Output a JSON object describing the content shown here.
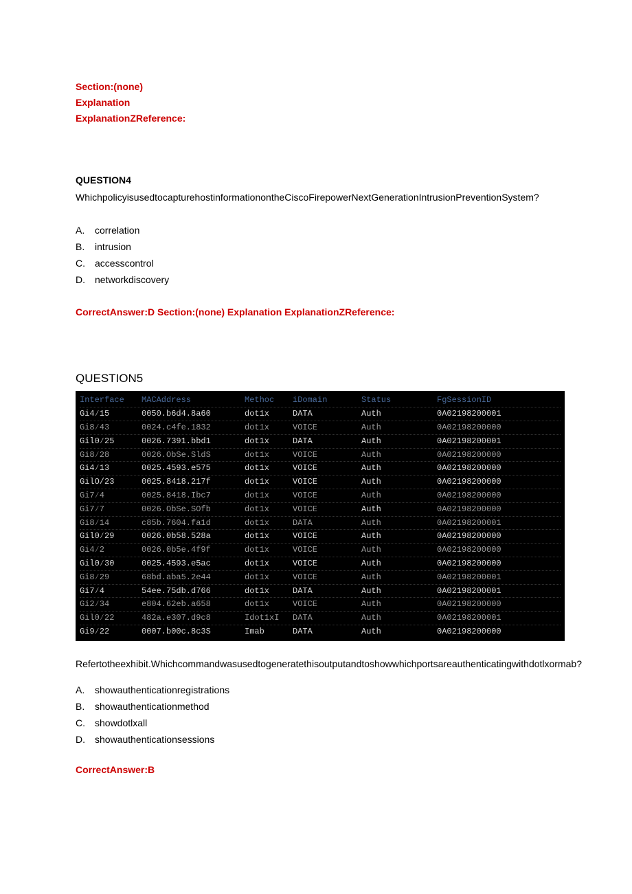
{
  "intro": {
    "section": "Section:(none)",
    "explanation": "Explanation",
    "expref": "ExplanationZReference:"
  },
  "q4": {
    "heading": "QUESTION4",
    "text": "WhichpolicyisusedtocapturehostinformationontheCiscoFirepowerNextGenerationIntrusionPreventionSystem?",
    "opts": [
      {
        "l": "A.",
        "t": "correlation"
      },
      {
        "l": "B.",
        "t": "intrusion"
      },
      {
        "l": "C.",
        "t": "accesscontrol"
      },
      {
        "l": "D.",
        "t": "networkdiscovery"
      }
    ],
    "correct": "CorrectAnswer:D",
    "section": "Section:(none)",
    "explanation": "Explanation",
    "expref": "ExplanationZReference:"
  },
  "q5": {
    "heading": "QUESTION5",
    "headers": {
      "c1": "Interface",
      "c2": "MACAddress",
      "c3": "Methoc",
      "c4": "iDomain",
      "c5": "Status",
      "c6": "FgSessionID"
    },
    "rows": [
      {
        "c1": "Gi4∕15",
        "c2": "0050.b6d4.8a60",
        "c3": "dot1x",
        "c4": "DATA",
        "c5": "Auth",
        "c6": "0A02198200001",
        "bright": true
      },
      {
        "c1": "Gi8∕43",
        "c2": "0024.c4fe.1832",
        "c3": "dot1x",
        "c4": "VOICE",
        "c5": "Auth",
        "c6": "0A02198200000"
      },
      {
        "c1": "Gil0∕25",
        "c2": "0026.7391.bbd1",
        "c3": "dot1x",
        "c4": "DATA",
        "c5": "Auth",
        "c6": "0A02198200001",
        "bright": true
      },
      {
        "c1": "Gi8∕28",
        "c2": "0026.ObSe.SldS",
        "c3": "dot1x",
        "c4": "VOICE",
        "c5": "Auth",
        "c6": "0A02198200000"
      },
      {
        "c1": "Gi4∕13",
        "c2": "0025.4593.e575",
        "c3": "dot1x",
        "c4": "VOICE",
        "c5": "Auth",
        "c6": "0A02198200000",
        "bright": true
      },
      {
        "c1": "GilO/23",
        "c2": "0025.8418.217f",
        "c3": "dot1x",
        "c4": "VOICE",
        "c5": "Auth",
        "c6": "0A02198200000",
        "bright": true
      },
      {
        "c1": "Gi7∕4",
        "c2": "0025.8418.Ibc7",
        "c3": "dot1x",
        "c4": "VOICE",
        "c5": "Auth",
        "c6": "0A02198200000"
      },
      {
        "c1": "Gi7∕7",
        "c2": "0026.ObSe.SOfb",
        "c3": "dot1x",
        "c4": "VOICE",
        "c5": "Auth",
        "c6": "0A02198200000",
        "statusBright": true
      },
      {
        "c1": "Gi8∕14",
        "c2": "c85b.7604.fa1d",
        "c3": "dot1x",
        "c4": "DATA",
        "c5": "Auth",
        "c6": "0A02198200001"
      },
      {
        "c1": "Gil0∕29",
        "c2": "0026.0b58.528a",
        "c3": "dot1x",
        "c4": "VOICE",
        "c5": "Auth",
        "c6": "0A02198200000",
        "bright": true
      },
      {
        "c1": "Gi4∕2",
        "c2": "0026.0b5e.4f9f",
        "c3": "dot1x",
        "c4": "VOICE",
        "c5": "Auth",
        "c6": "0A02198200000"
      },
      {
        "c1": "Gil0∕30",
        "c2": "0025.4593.e5ac",
        "c3": "dot1x",
        "c4": "VOICE",
        "c5": "Auth",
        "c6": "0A02198200000",
        "bright": true
      },
      {
        "c1": "Gi8∕29",
        "c2": "68bd.aba5.2e44",
        "c3": "dot1x",
        "c4": "VOICE",
        "c5": "Auth",
        "c6": "0A02198200001"
      },
      {
        "c1": "Gi7∕4",
        "c2": "54ee.75db.d766",
        "c3": "dot1x",
        "c4": "DATA",
        "c5": "Auth",
        "c6": "0A02198200001",
        "bright": true
      },
      {
        "c1": "Gi2∕34",
        "c2": "e804.62eb.a658",
        "c3": "dot1x",
        "c4": "VOICE",
        "c5": "Auth",
        "c6": "0A02198200000"
      },
      {
        "c1": "Gil0∕22",
        "c2": "482a.e307.d9c8",
        "c3": "Idot1xI",
        "c4": "DATA",
        "c5": "Auth",
        "c6": "0A02198200001"
      },
      {
        "c1": "Gi9∕22",
        "c2": "0007.b00c.8c3S",
        "c3": "Imab",
        "c4": "DATA",
        "c5": "Auth",
        "c6": "0A02198200000",
        "bright": true,
        "statusBright": true
      }
    ],
    "text": "Refertotheexhibit.Whichcommandwasusedtogeneratethisoutputandtoshowwhichportsareauthenticatingwithdotlxormab?",
    "opts": [
      {
        "l": "A.",
        "t": "showauthenticationregistrations"
      },
      {
        "l": "B.",
        "t": "showauthenticationmethod"
      },
      {
        "l": "C.",
        "t": "showdotlxall"
      },
      {
        "l": "D.",
        "t": "showauthenticationsessions"
      }
    ],
    "correct": "CorrectAnswer:B"
  }
}
